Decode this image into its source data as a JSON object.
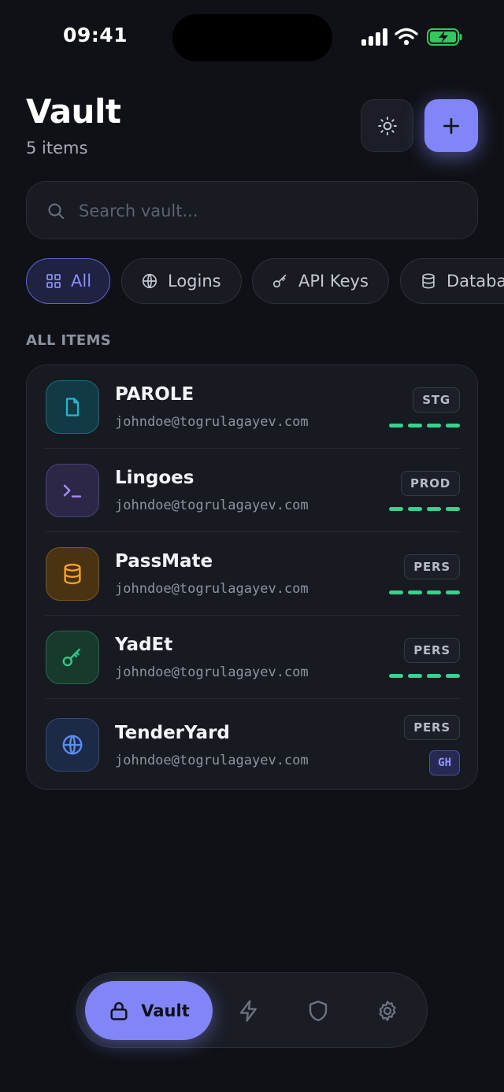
{
  "status_bar": {
    "time": "09:41"
  },
  "header": {
    "title": "Vault",
    "subtitle": "5 items"
  },
  "search": {
    "placeholder": "Search vault..."
  },
  "filters": [
    {
      "label": "All",
      "icon": "grid-icon",
      "active": true
    },
    {
      "label": "Logins",
      "icon": "globe-icon",
      "active": false
    },
    {
      "label": "API Keys",
      "icon": "key-icon",
      "active": false
    },
    {
      "label": "Databases",
      "icon": "database-icon",
      "active": false
    }
  ],
  "section_label": "ALL ITEMS",
  "items": [
    {
      "name": "PAROLE",
      "email": "johndoe@togrulagayev.com",
      "env": "STG",
      "icon": "file-icon",
      "icon_color": "#22b8cf",
      "strength_bars": 4
    },
    {
      "name": "Lingoes",
      "email": "johndoe@togrulagayev.com",
      "env": "PROD",
      "icon": "terminal-icon",
      "icon_color": "#a78bfa",
      "strength_bars": 4
    },
    {
      "name": "PassMate",
      "email": "johndoe@togrulagayev.com",
      "env": "PERS",
      "icon": "database-icon",
      "icon_color": "#f5a524",
      "strength_bars": 4
    },
    {
      "name": "YadEt",
      "email": "johndoe@togrulagayev.com",
      "env": "PERS",
      "icon": "key-icon",
      "icon_color": "#2ecc8a",
      "strength_bars": 4
    },
    {
      "name": "TenderYard",
      "email": "johndoe@togrulagayev.com",
      "env": "PERS",
      "icon": "globe-icon",
      "icon_color": "#5b8def",
      "tag": "GH"
    }
  ],
  "tabbar": {
    "active_label": "Vault"
  },
  "colors": {
    "accent": "#8185f7",
    "background": "#0f1116",
    "strength": "#35d38e"
  }
}
